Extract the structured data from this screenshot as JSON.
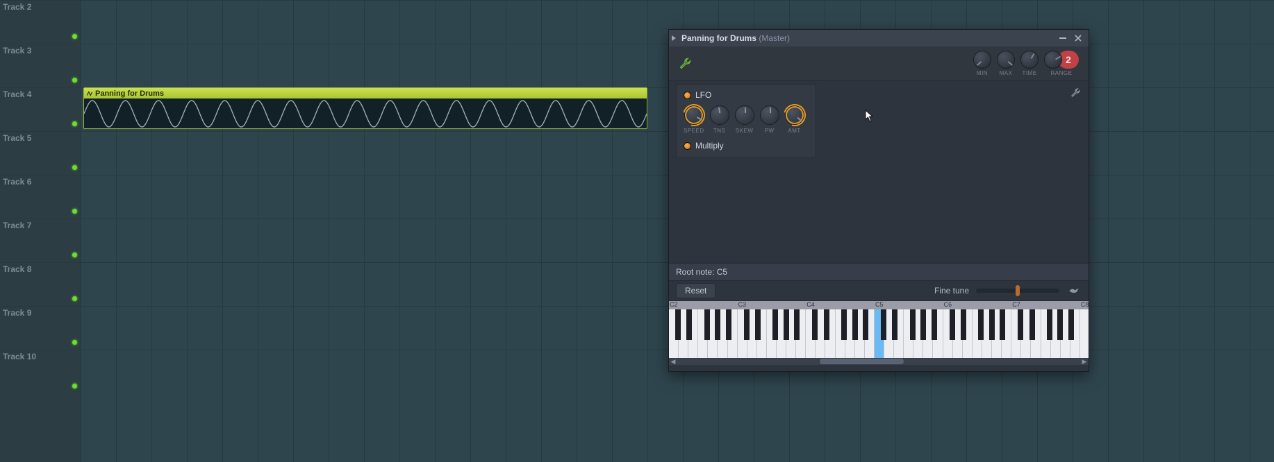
{
  "tracks": [
    {
      "name": "Track 2"
    },
    {
      "name": "Track 3"
    },
    {
      "name": "Track 4"
    },
    {
      "name": "Track 5"
    },
    {
      "name": "Track 6"
    },
    {
      "name": "Track 7"
    },
    {
      "name": "Track 8"
    },
    {
      "name": "Track 9"
    },
    {
      "name": "Track 10"
    }
  ],
  "clip": {
    "name": "Panning for Drums"
  },
  "editor": {
    "title_main": "Panning for Drums",
    "title_sub": "(Master)",
    "range_value": "2",
    "header_knobs": [
      {
        "label": "Min"
      },
      {
        "label": "Max"
      },
      {
        "label": "Time"
      },
      {
        "label": "Range"
      }
    ],
    "lfo": {
      "title": "LFO",
      "knobs": [
        {
          "label": "Speed",
          "accent": true
        },
        {
          "label": "TNS",
          "accent": false
        },
        {
          "label": "Skew",
          "accent": false
        },
        {
          "label": "PW",
          "accent": false
        },
        {
          "label": "Amt",
          "accent": true
        }
      ],
      "multiply_label": "Multiply"
    },
    "root_note_label": "Root note: C5",
    "reset_label": "Reset",
    "fine_tune_label": "Fine tune",
    "piano": {
      "octaves": [
        "C2",
        "C3",
        "C4",
        "C5",
        "C6",
        "C7",
        "C8"
      ],
      "selected": "C5"
    }
  }
}
